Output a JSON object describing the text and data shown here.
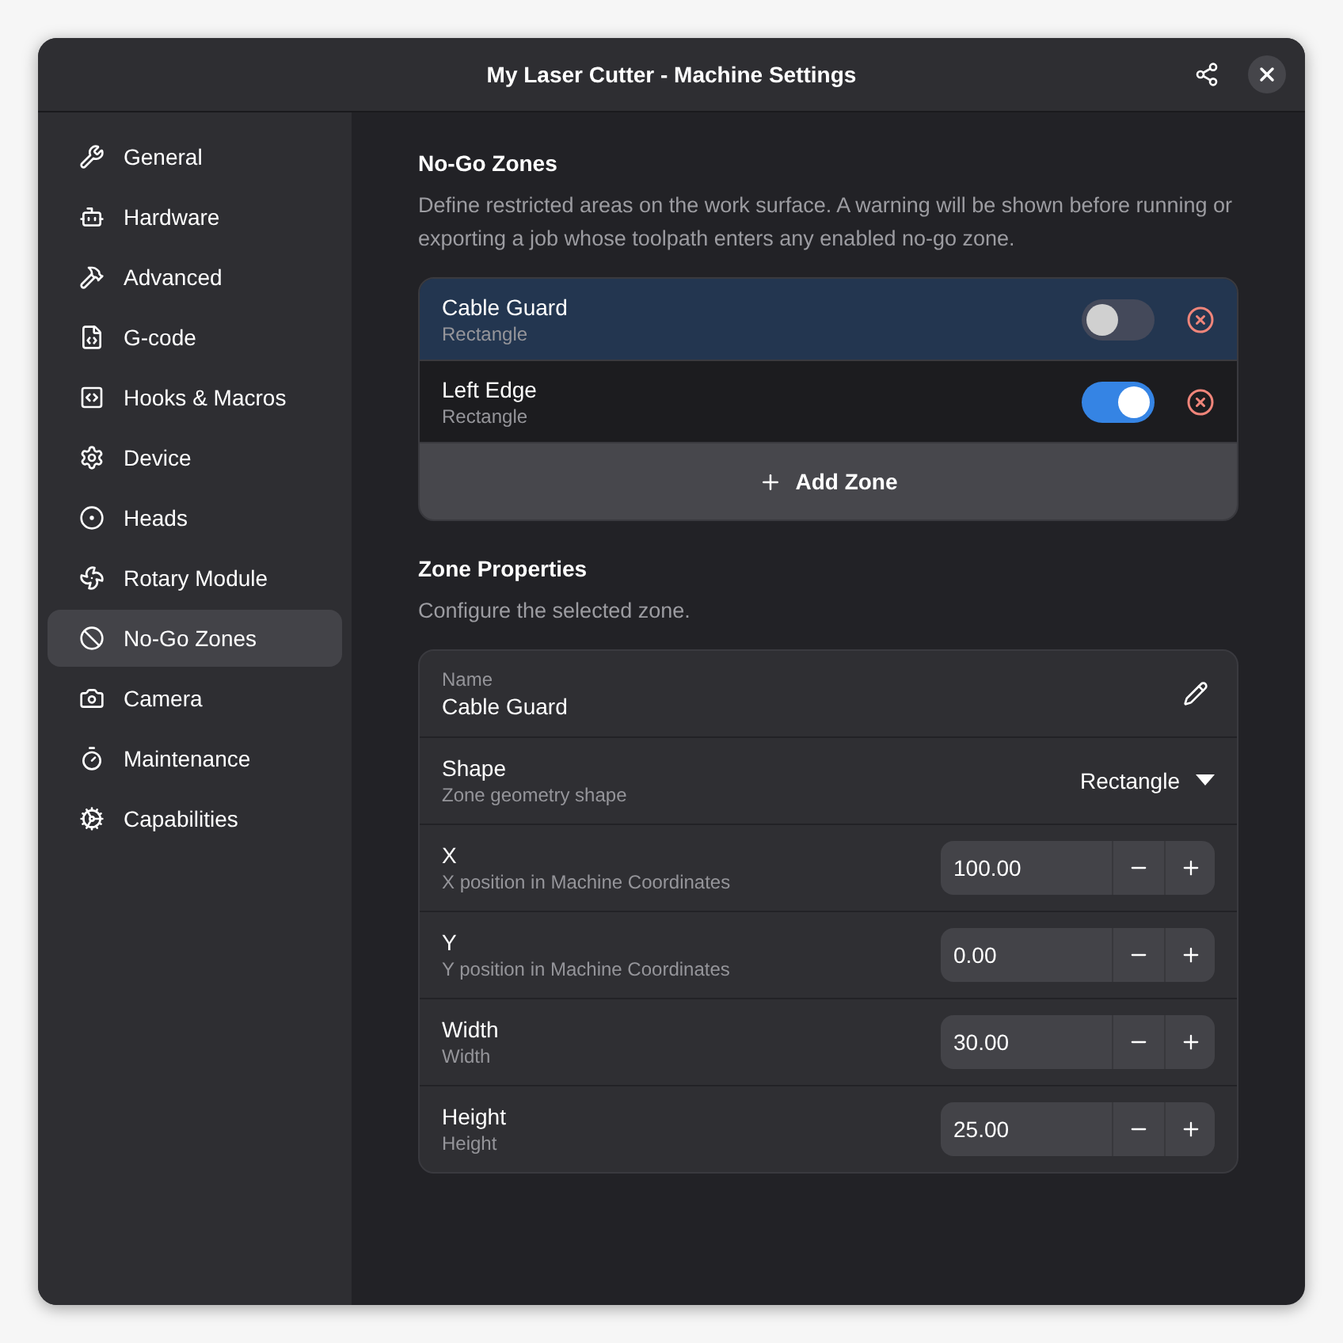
{
  "window": {
    "title": "My Laser Cutter - Machine Settings"
  },
  "sidebar": {
    "items": [
      {
        "label": "General",
        "selected": false
      },
      {
        "label": "Hardware",
        "selected": false
      },
      {
        "label": "Advanced",
        "selected": false
      },
      {
        "label": "G-code",
        "selected": false
      },
      {
        "label": "Hooks & Macros",
        "selected": false
      },
      {
        "label": "Device",
        "selected": false
      },
      {
        "label": "Heads",
        "selected": false
      },
      {
        "label": "Rotary Module",
        "selected": false
      },
      {
        "label": "No-Go Zones",
        "selected": true
      },
      {
        "label": "Camera",
        "selected": false
      },
      {
        "label": "Maintenance",
        "selected": false
      },
      {
        "label": "Capabilities",
        "selected": false
      }
    ]
  },
  "zones_section": {
    "title": "No-Go Zones",
    "description": "Define restricted areas on the work surface. A warning will be shown before running or exporting a job whose toolpath enters any enabled no-go zone.",
    "zones": [
      {
        "name": "Cable Guard",
        "shape": "Rectangle",
        "selected": true,
        "on": false
      },
      {
        "name": "Left Edge",
        "shape": "Rectangle",
        "selected": false,
        "on": true
      }
    ],
    "add_button": "Add Zone"
  },
  "properties_section": {
    "title": "Zone Properties",
    "description": "Configure the selected zone.",
    "rows": [
      {
        "kind": "entry",
        "label": "Name",
        "value": "Cable Guard"
      },
      {
        "kind": "dropdown",
        "label": "Shape",
        "subtitle": "Zone geometry shape",
        "value": "Rectangle"
      },
      {
        "kind": "spin",
        "label": "X",
        "subtitle": "X position in Machine Coordinates",
        "value": "100.00"
      },
      {
        "kind": "spin",
        "label": "Y",
        "subtitle": "Y position in Machine Coordinates",
        "value": "0.00"
      },
      {
        "kind": "spin",
        "label": "Width",
        "subtitle": "Width",
        "value": "30.00"
      },
      {
        "kind": "spin",
        "label": "Height",
        "subtitle": "Height",
        "value": "25.00"
      }
    ]
  }
}
